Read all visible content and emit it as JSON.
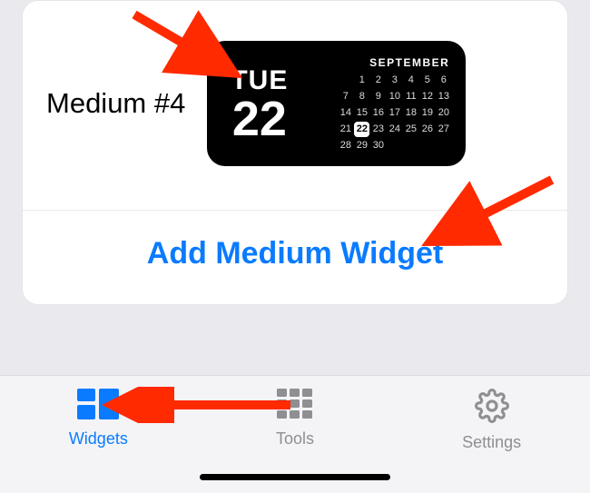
{
  "colors": {
    "accent": "#0a7bff",
    "inactive": "#8e8e93"
  },
  "widget_row": {
    "label": "Medium #4",
    "preview": {
      "day_of_week": "TUE",
      "day_number": "22",
      "month": "SEPTEMBER",
      "calendar": {
        "leading_blanks": 1,
        "days_in_month": 30,
        "highlighted_day": 22
      }
    }
  },
  "add_button": {
    "label": "Add Medium Widget"
  },
  "tabbar": {
    "items": [
      {
        "key": "widgets",
        "label": "Widgets",
        "active": true
      },
      {
        "key": "tools",
        "label": "Tools",
        "active": false
      },
      {
        "key": "settings",
        "label": "Settings",
        "active": false
      }
    ]
  }
}
